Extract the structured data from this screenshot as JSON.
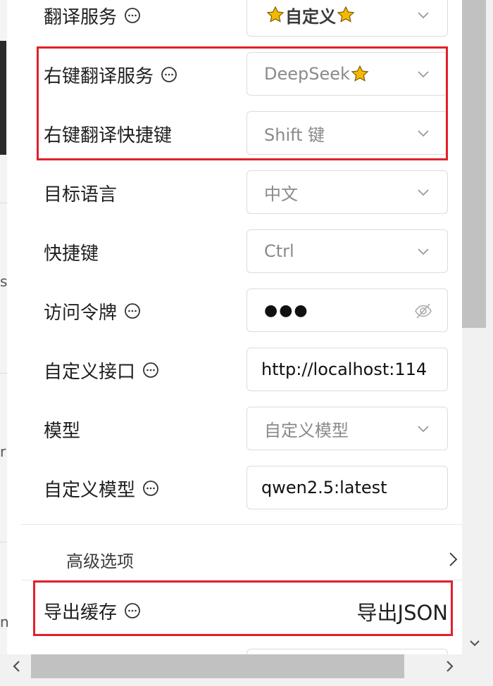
{
  "settings": {
    "rows": [
      {
        "label": "翻译服务",
        "value": "自定义",
        "has_help": true,
        "type": "select-star"
      },
      {
        "label": "右键翻译服务",
        "value": "DeepSeek",
        "has_help": true,
        "type": "select-star-after"
      },
      {
        "label": "右键翻译快捷键",
        "value": "Shift 键",
        "has_help": false,
        "type": "select"
      },
      {
        "label": "目标语言",
        "value": "中文",
        "has_help": false,
        "type": "select"
      },
      {
        "label": "快捷键",
        "value": "Ctrl",
        "has_help": false,
        "type": "select"
      },
      {
        "label": "访问令牌",
        "value": "●●●",
        "has_help": true,
        "type": "password"
      },
      {
        "label": "自定义接口",
        "value": "http://localhost:114",
        "has_help": true,
        "type": "input"
      },
      {
        "label": "模型",
        "value": "自定义模型",
        "has_help": false,
        "type": "select"
      },
      {
        "label": "自定义模型",
        "value": "qwen2.5:latest",
        "has_help": true,
        "type": "input"
      }
    ]
  },
  "advanced": {
    "label": "高级选项"
  },
  "export": {
    "label": "导出缓存",
    "button": "导出JSON"
  },
  "icons": {
    "help": "message-circle-icon",
    "dropdown": "chevron-down-icon",
    "star": "star-icon",
    "eye": "eye-slash-icon",
    "advanced_arrow": "chevron-right-icon"
  },
  "colors": {
    "highlight": "#e3202a",
    "star_fill": "#f5b800",
    "border": "#dcdcdc",
    "disabled_text": "#8a8a8a"
  }
}
